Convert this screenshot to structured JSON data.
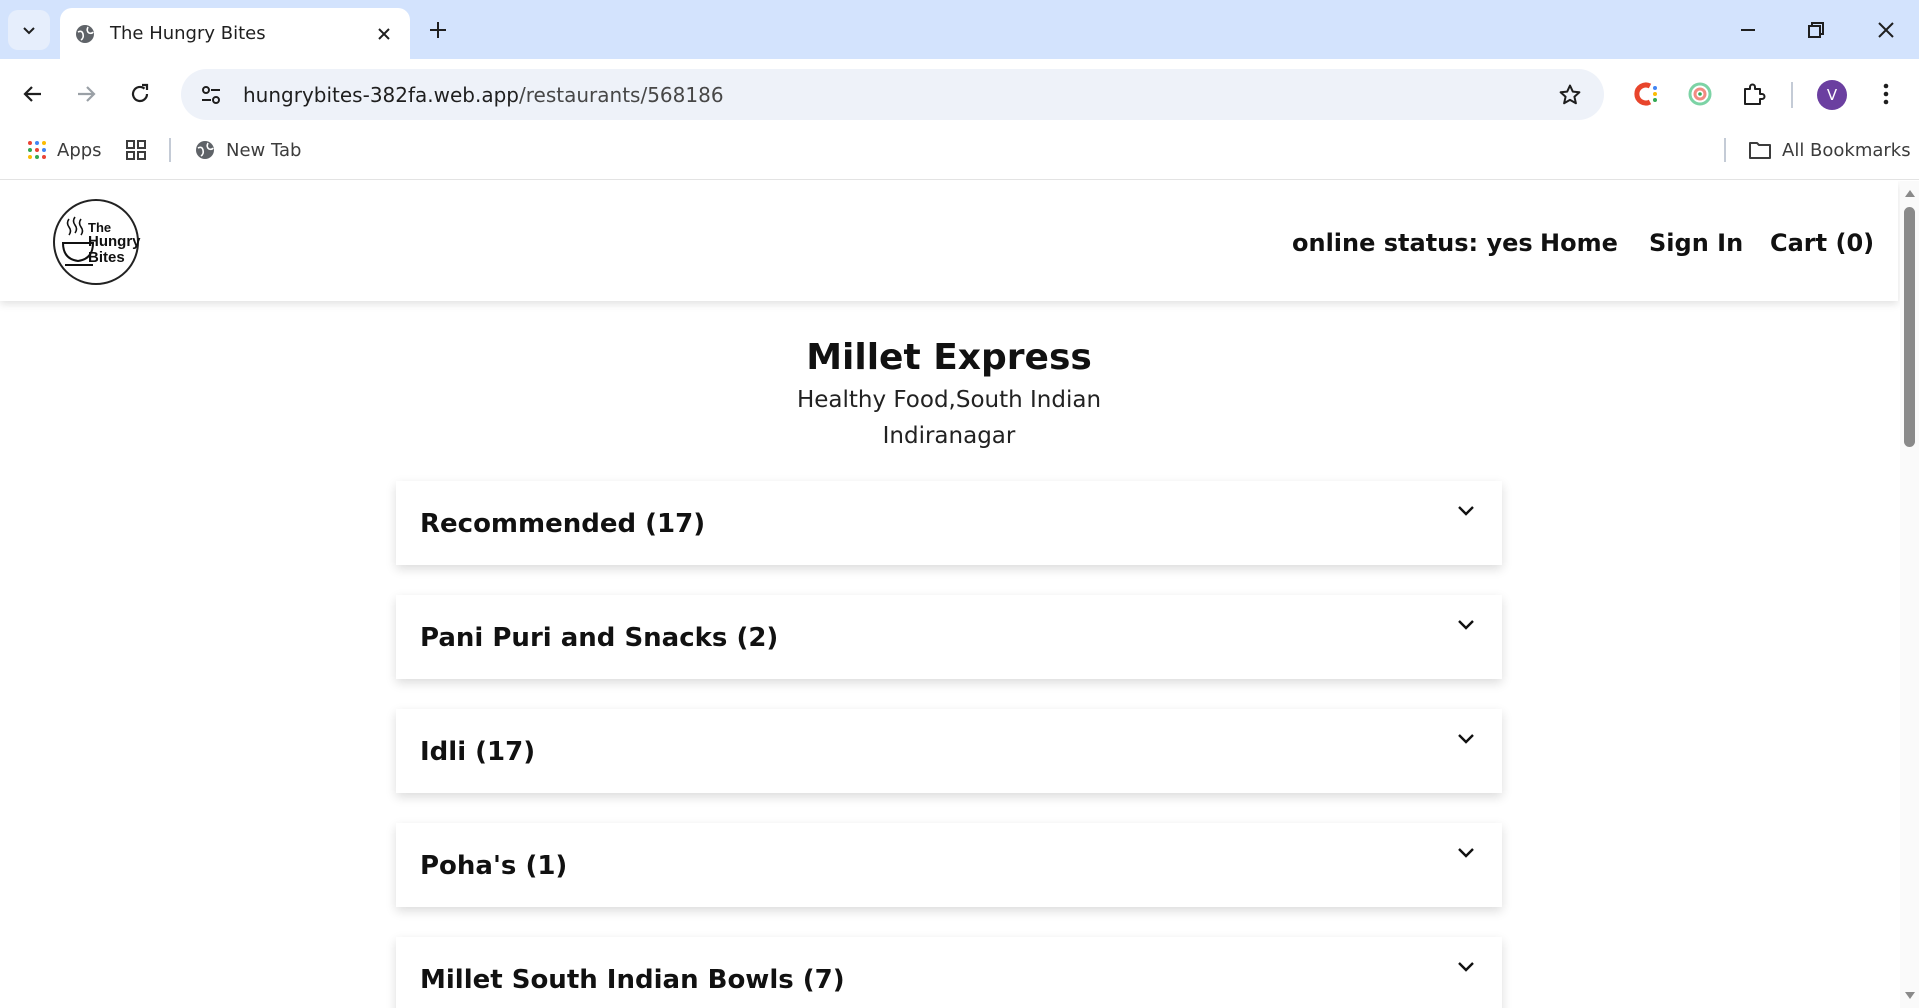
{
  "browser": {
    "tab_title": "The Hungry Bites",
    "url_host": "hungrybites-382fa.web.app",
    "url_path": "/restaurants/568186",
    "profile_initial": "V",
    "bookmarks": {
      "apps_label": "Apps",
      "new_tab_label": "New Tab",
      "all_bookmarks_label": "All Bookmarks"
    }
  },
  "site": {
    "logo": {
      "line1": "The",
      "line2": "Hungry",
      "line3": "Bites"
    },
    "nav": {
      "online_status": "online status: yes",
      "home": "Home",
      "sign_in": "Sign In",
      "cart": "Cart (0)"
    }
  },
  "restaurant": {
    "name": "Millet Express",
    "cuisines": "Healthy Food,South Indian",
    "area": "Indiranagar"
  },
  "menu_categories": [
    {
      "title": "Recommended (17)"
    },
    {
      "title": "Pani Puri and Snacks (2)"
    },
    {
      "title": "Idli (17)"
    },
    {
      "title": "Poha's (1)"
    },
    {
      "title": "Millet South Indian Bowls (7)"
    }
  ]
}
